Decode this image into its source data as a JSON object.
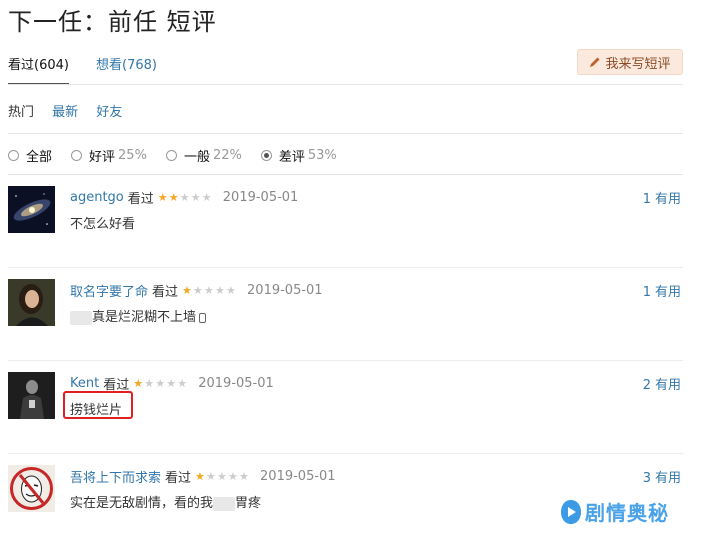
{
  "page": {
    "title": "下一任：前任 短评"
  },
  "tabs": [
    {
      "label": "看过(604)",
      "active": true
    },
    {
      "label": "想看(768)",
      "active": false
    }
  ],
  "write_button": {
    "label": "我来写短评",
    "icon": "pencil-icon"
  },
  "sort": {
    "hot": "热门",
    "latest": "最新",
    "friends": "好友"
  },
  "filters": [
    {
      "label": "全部",
      "pct": "",
      "checked": false
    },
    {
      "label": "好评",
      "pct": "25%",
      "checked": false
    },
    {
      "label": "一般",
      "pct": "22%",
      "checked": false
    },
    {
      "label": "差评",
      "pct": "53%",
      "checked": true
    }
  ],
  "reviews": [
    {
      "user": "agentgo",
      "seen": "看过",
      "rating": 2,
      "date": "2019-05-01",
      "text": "不怎么好看",
      "votes": "1",
      "votes_label": "有用",
      "avatar": "galaxy-avatar"
    },
    {
      "user": "取名字要了命",
      "seen": "看过",
      "rating": 1,
      "date": "2019-05-01",
      "text": "真是烂泥糊不上墙",
      "votes": "1",
      "votes_label": "有用",
      "avatar": "portrait-avatar"
    },
    {
      "user": "Kent",
      "seen": "看过",
      "rating": 1,
      "date": "2019-05-01",
      "text": "捞钱烂片",
      "votes": "2",
      "votes_label": "有用",
      "avatar": "dark-portrait-avatar"
    },
    {
      "user": "吾将上下而求索",
      "seen": "看过",
      "rating": 1,
      "date": "2019-05-01",
      "text": "实在是无敌剧情，看的我",
      "text_tail": "胃疼",
      "votes": "3",
      "votes_label": "有用",
      "avatar": "mask-avatar"
    }
  ],
  "watermark": {
    "text": "剧情奥秘",
    "icon": "play-icon"
  },
  "colors": {
    "link": "#3377aa",
    "star": "#f5a623",
    "highlight": "#e02020",
    "button_bg": "#fbe9dd"
  }
}
